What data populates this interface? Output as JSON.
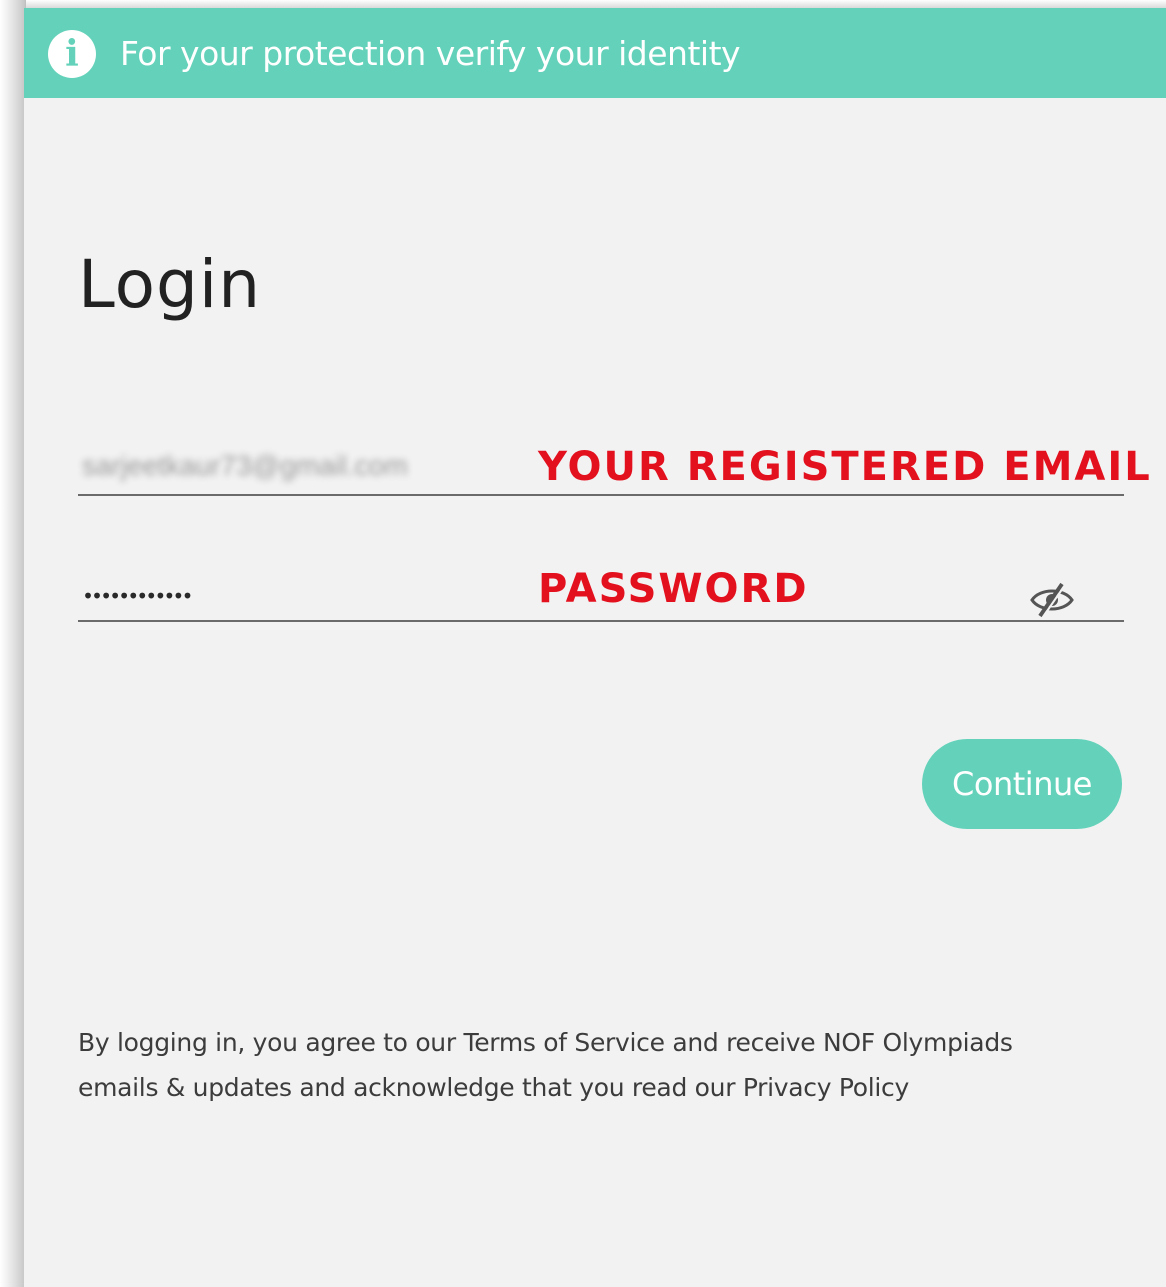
{
  "banner": {
    "icon": "info-icon",
    "icon_glyph": "i",
    "text": "For your protection verify your identity",
    "color": "#64d2ba"
  },
  "login": {
    "title": "Login"
  },
  "email_field": {
    "value": "sarjeetkaur73@gmail.com",
    "annotation": "YOUR REGISTERED EMAIL"
  },
  "password_field": {
    "value": "••••••••••••",
    "annotation": "PASSWORD",
    "toggle_icon": "eye-slash-icon"
  },
  "continue_button": {
    "label": "Continue"
  },
  "disclaimer": {
    "line1": "By logging in, you agree to our Terms of Service and receive NOF Olympiads",
    "line2": "emails & updates and acknowledge that you read our Privacy Policy"
  },
  "colors": {
    "accent": "#64d2ba",
    "annotation_red": "#e3101e",
    "background": "#f2f2f2"
  }
}
